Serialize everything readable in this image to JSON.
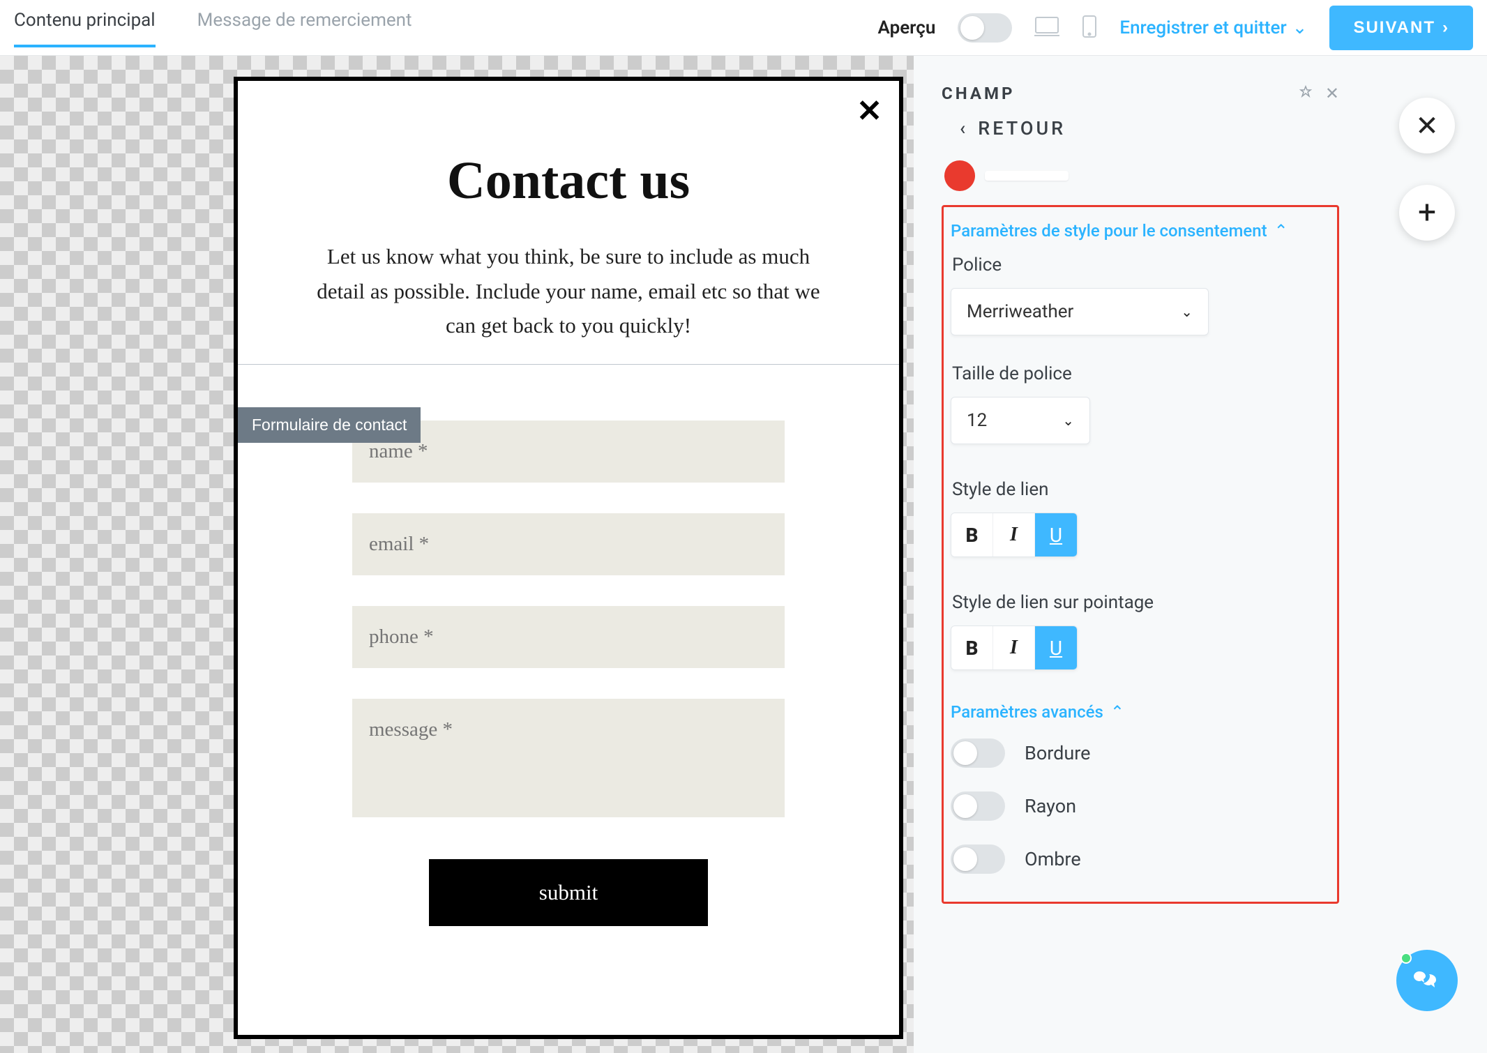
{
  "topbar": {
    "tab_main": "Contenu principal",
    "tab_thanks": "Message de remerciement",
    "preview_label": "Aperçu",
    "save_exit": "Enregistrer et quitter",
    "next": "SUIVANT"
  },
  "form": {
    "title": "Contact us",
    "description": "Let us know what you think, be sure to include as much detail as possible. Include your name, email etc so that we can get back to you quickly!",
    "tag": "Formulaire de contact",
    "fields": {
      "name": "name *",
      "email": "email *",
      "phone": "phone *",
      "message": "message *"
    },
    "submit": "submit"
  },
  "panel": {
    "title": "CHAMP",
    "back": "RETOUR",
    "section_consent": "Paramètres de style pour le consentement",
    "font_label": "Police",
    "font_value": "Merriweather",
    "fontsize_label": "Taille de police",
    "fontsize_value": "12",
    "linkstyle_label": "Style de lien",
    "linkhover_label": "Style de lien sur pointage",
    "style_b": "B",
    "style_i": "I",
    "style_u": "U",
    "section_advanced": "Paramètres avancés",
    "border": "Bordure",
    "radius": "Rayon",
    "shadow": "Ombre"
  }
}
